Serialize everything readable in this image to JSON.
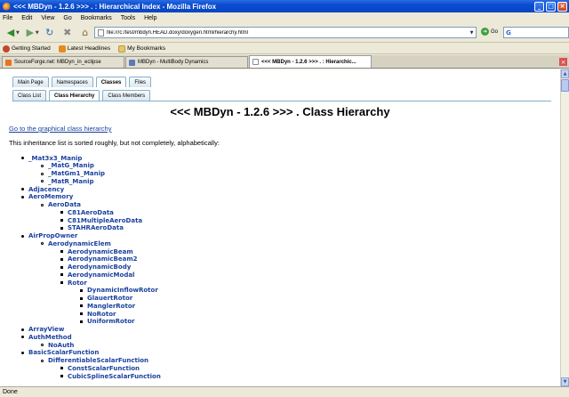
{
  "window": {
    "title": "<<< MBDyn - 1.2.6 >>> . : Hierarchical Index - Mozilla Firefox",
    "minimize": "_",
    "maximize": "□",
    "close": "×"
  },
  "menu": [
    "File",
    "Edit",
    "View",
    "Go",
    "Bookmarks",
    "Tools",
    "Help"
  ],
  "nav": {
    "url": "file:///c:/test/mbdyn.HEAD.doxy/doxygen.html/hierarchy.html",
    "go_label": "Go",
    "search_engine_glyph": "G"
  },
  "bookmarks": [
    {
      "label": "Getting Started",
      "color": "#c2452c"
    },
    {
      "label": "Latest Headlines",
      "color": "#e68a1c"
    },
    {
      "label": "My Bookmarks",
      "color": "#e8c66a"
    }
  ],
  "browser_tabs": [
    {
      "label": "SourceForge.net: MBDyn_in_eclipse",
      "active": false,
      "color": "#e8741c"
    },
    {
      "label": "MBDyn - MultiBody Dynamics",
      "active": false,
      "color": "#5a7ab8"
    },
    {
      "label": "<<< MBDyn - 1.2.6 >>> . : Hierarchic...",
      "active": true,
      "color": "#aac"
    }
  ],
  "doc_tabs_primary": [
    {
      "label": "Main Page",
      "current": false
    },
    {
      "label": "Namespaces",
      "current": false
    },
    {
      "label": "Classes",
      "current": true
    },
    {
      "label": "Files",
      "current": false
    }
  ],
  "doc_tabs_secondary": [
    {
      "label": "Class List",
      "current": false
    },
    {
      "label": "Class Hierarchy",
      "current": true
    },
    {
      "label": "Class Members",
      "current": false
    }
  ],
  "page": {
    "title": "<<< MBDyn - 1.2.6 >>> . Class Hierarchy",
    "graph_link": "Go to the graphical class hierarchy",
    "intro": "This inheritance list is sorted roughly, but not completely, alphabetically:"
  },
  "tree": [
    {
      "label": "_Mat3x3_Manip",
      "level": 0
    },
    {
      "label": "_MatG_Manip",
      "level": 1
    },
    {
      "label": "_MatGm1_Manip",
      "level": 1
    },
    {
      "label": "_MatR_Manip",
      "level": 1
    },
    {
      "label": "Adjacency",
      "level": 0
    },
    {
      "label": "AeroMemory",
      "level": 0
    },
    {
      "label": "AeroData",
      "level": 1
    },
    {
      "label": "C81AeroData",
      "level": 2
    },
    {
      "label": "C81MultipleAeroData",
      "level": 2
    },
    {
      "label": "STAHRAeroData",
      "level": 2
    },
    {
      "label": "AirPropOwner",
      "level": 0
    },
    {
      "label": "AerodynamicElem",
      "level": 1
    },
    {
      "label": "AerodynamicBeam",
      "level": 2
    },
    {
      "label": "AerodynamicBeam2",
      "level": 2
    },
    {
      "label": "AerodynamicBody",
      "level": 2
    },
    {
      "label": "AerodynamicModal",
      "level": 2
    },
    {
      "label": "Rotor",
      "level": 2
    },
    {
      "label": "DynamicInflowRotor",
      "level": 3
    },
    {
      "label": "GlauertRotor",
      "level": 3
    },
    {
      "label": "ManglerRotor",
      "level": 3
    },
    {
      "label": "NoRotor",
      "level": 3
    },
    {
      "label": "UniformRotor",
      "level": 3
    },
    {
      "label": "ArrayView",
      "level": 0
    },
    {
      "label": "AuthMethod",
      "level": 0
    },
    {
      "label": "NoAuth",
      "level": 1
    },
    {
      "label": "BasicScalarFunction",
      "level": 0
    },
    {
      "label": "DifferentiableScalarFunction",
      "level": 1
    },
    {
      "label": "ConstScalarFunction",
      "level": 2
    },
    {
      "label": "CubicSplineScalarFunction",
      "level": 2
    }
  ],
  "status": "Done"
}
